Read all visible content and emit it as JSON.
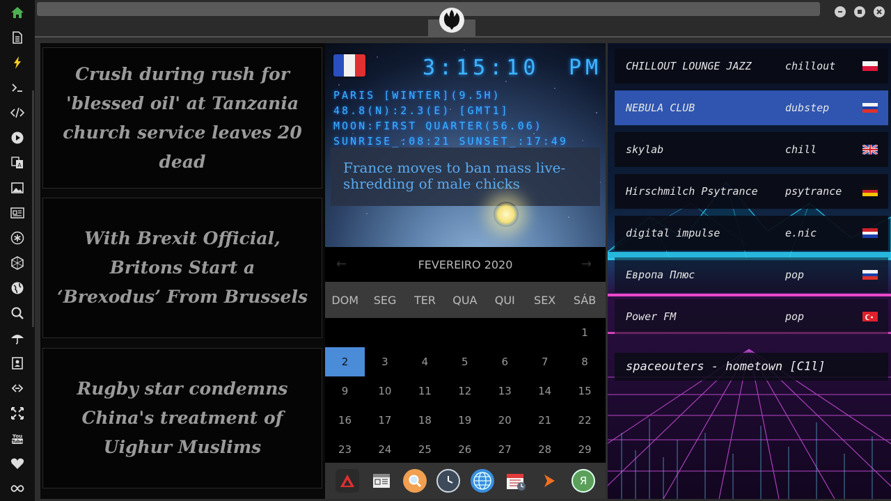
{
  "sidebar": {
    "icons": [
      "home-icon",
      "document-icon",
      "bolt-icon",
      "terminal-icon",
      "code-icon",
      "play-icon",
      "translate-icon",
      "image-icon",
      "newspaper-icon",
      "asterisk-icon",
      "hexagon-icon",
      "globe-icon",
      "search-icon",
      "umbrella-icon",
      "contacts-icon",
      "link-icon",
      "expand-icon",
      "youtube-icon",
      "heart-icon",
      "infinity-icon"
    ],
    "accent": "#4caf50"
  },
  "news": [
    {
      "headline": "Crush during rush for 'blessed oil' at Tanzania church service leaves 20 dead"
    },
    {
      "headline": "With Brexit Official, Britons Start a ‘Brexodus’ From Brussels"
    },
    {
      "headline": "Rugby star condemns China's treatment of Uighur Muslims"
    }
  ],
  "weather": {
    "flag": "france-flag",
    "time": "3:15:10",
    "ampm": "PM",
    "lines": [
      "PARIS [WINTER](9.5H)",
      "48.8(N):2.3(E) [GMT1]",
      "MOON:FIRST QUARTER(56.06)",
      "SUNRISE_:08:21 SUNSET_:17:49"
    ],
    "headline": "France moves to ban mass live-shredding of male chicks",
    "color": "#39b3ff"
  },
  "calendar": {
    "month": "FEVEREIRO 2020",
    "prev": "←",
    "next": "→",
    "weekdays": [
      "DOM",
      "SEG",
      "TER",
      "QUA",
      "QUI",
      "SEX",
      "SÁB"
    ],
    "first_weekday": 6,
    "days": 29,
    "selected": 2,
    "selected_color": "#4a8cd8"
  },
  "dock": {
    "icons": [
      "vivaldi-icon",
      "news-reader-icon",
      "search-app-icon",
      "clock-app-icon",
      "browser-globe-icon",
      "calendar-app-icon",
      "play-arrow-icon",
      "yandex-icon"
    ]
  },
  "radio": {
    "stations": [
      {
        "name": "CHILLOUT LOUNGE JAZZ",
        "genre": "chillout",
        "flag": "poland-flag",
        "active": false
      },
      {
        "name": "NEBULA CLUB",
        "genre": "dubstep",
        "flag": "russia-flag",
        "active": true
      },
      {
        "name": "skylab",
        "genre": "chill",
        "flag": "uk-flag",
        "active": false
      },
      {
        "name": "Hirschmilch Psytrance",
        "genre": "psytrance",
        "flag": "germany-flag",
        "active": false
      },
      {
        "name": "digital impulse",
        "genre": "e.nic",
        "flag": "croatia-flag",
        "active": false
      },
      {
        "name": "Европа Плюс",
        "genre": "pop",
        "flag": "russia-flag",
        "active": false
      },
      {
        "name": "Power FM",
        "genre": "pop",
        "flag": "turkey-flag",
        "active": false
      }
    ],
    "now_playing": "spaceouters - hometown [C1l]",
    "active_color": "#2f55b0"
  }
}
